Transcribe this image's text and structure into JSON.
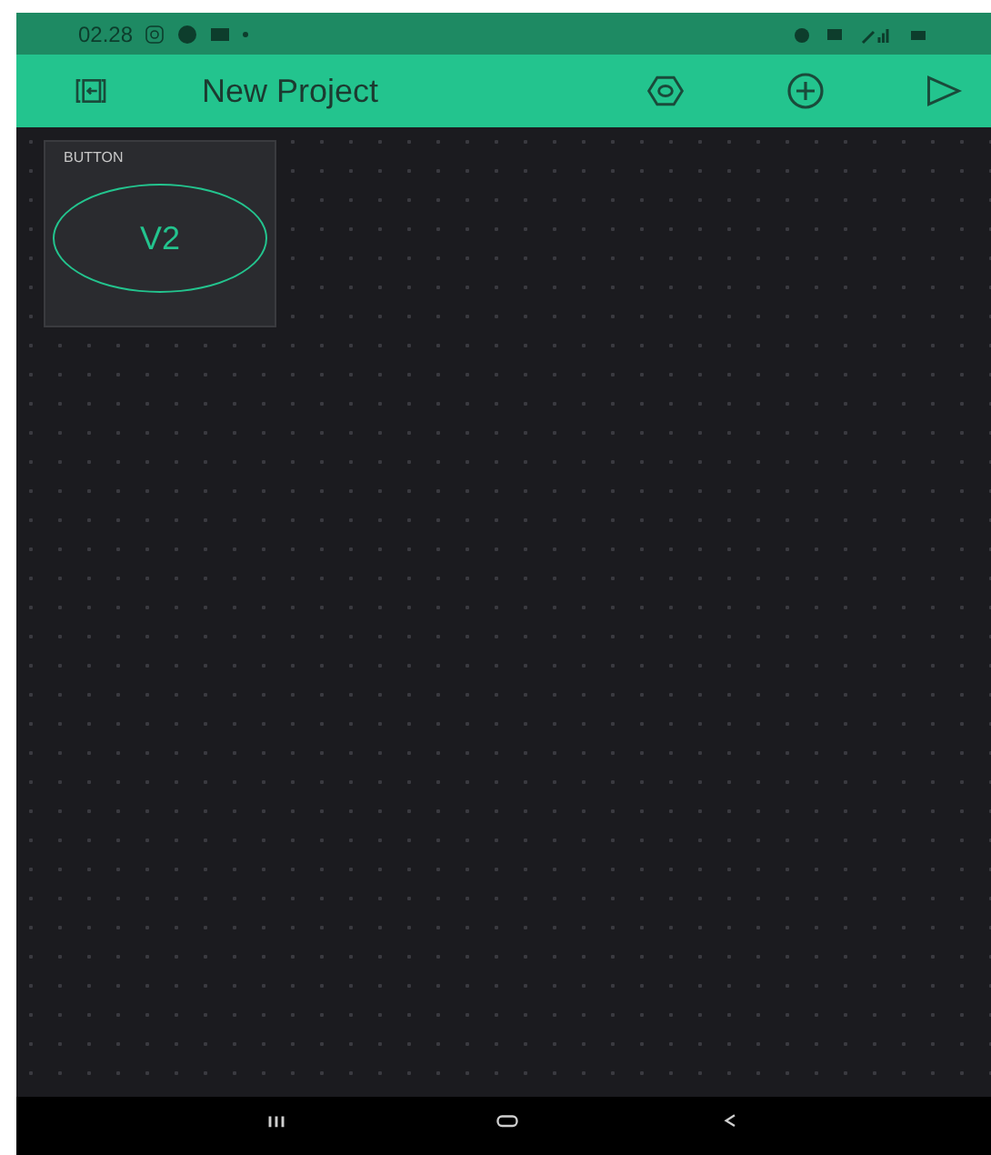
{
  "status_bar": {
    "time": "02.28"
  },
  "app_bar": {
    "title": "New Project"
  },
  "widgets": [
    {
      "kind": "button",
      "label": "BUTTON",
      "pin": "V2"
    }
  ]
}
